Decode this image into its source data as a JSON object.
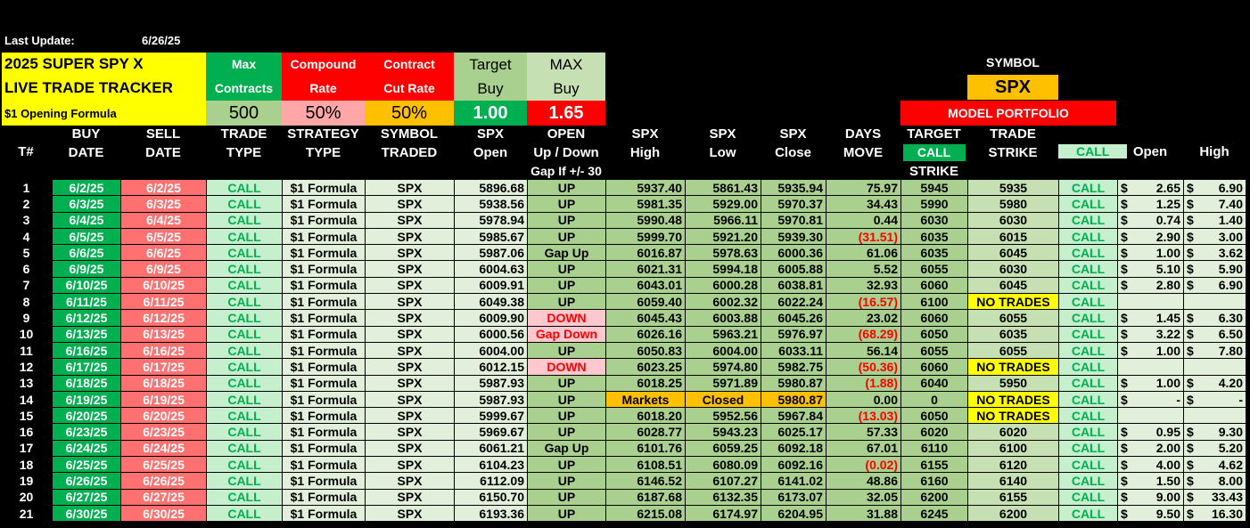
{
  "last_update_label": "Last Update:",
  "last_update_date": "6/26/25",
  "title": {
    "line1": "2025 SUPER SPY X",
    "line2": "LIVE TRADE TRACKER",
    "line3": "$1 Opening Formula"
  },
  "params": {
    "max_contracts": {
      "l1": "Max",
      "l2": "Contracts",
      "value": "500"
    },
    "compound_rate": {
      "l1": "Compound",
      "l2": "Rate",
      "value": "50%"
    },
    "cut_rate": {
      "l1": "Contract",
      "l2": "Cut Rate",
      "value": "50%"
    },
    "target_buy": {
      "l1": "Target",
      "l2": "Buy",
      "value": "1.00"
    },
    "max_buy": {
      "l1": "MAX",
      "l2": "Buy",
      "value": "1.65"
    }
  },
  "symbol_label": "SYMBOL",
  "symbol_value": "SPX",
  "model_portfolio": "MODEL PORTFOLIO",
  "headers": {
    "num": "T#",
    "buy": [
      "BUY",
      "DATE"
    ],
    "sell": [
      "SELL",
      "DATE"
    ],
    "trade_type": [
      "TRADE",
      "TYPE"
    ],
    "strategy": [
      "STRATEGY",
      "TYPE"
    ],
    "symbol": [
      "SYMBOL",
      "TRADED"
    ],
    "spx_open": [
      "SPX",
      "Open"
    ],
    "open_dir": [
      "OPEN",
      "Up / Down",
      "Gap If +/- 30"
    ],
    "spx_high": [
      "SPX",
      "High"
    ],
    "spx_low": [
      "SPX",
      "Low"
    ],
    "spx_close": [
      "SPX",
      "Close"
    ],
    "days_move": [
      "DAYS",
      "MOVE"
    ],
    "target": [
      "TARGET",
      "CALL",
      "STRIKE"
    ],
    "trade_strike": [
      "TRADE",
      "STRIKE"
    ],
    "call": "CALL",
    "open": "Open",
    "high": "High"
  },
  "rows": [
    {
      "n": "1",
      "buy": "6/2/25",
      "sell": "6/2/25",
      "type": "CALL",
      "strategy": "$1 Formula",
      "symbol": "SPX",
      "open": "5896.68",
      "dir": "UP",
      "high": "5937.40",
      "low": "5861.43",
      "close": "5935.94",
      "move": "75.97",
      "target": "5945",
      "strike": "5935",
      "call": "CALL",
      "opt_open": "2.65",
      "opt_high": "6.90"
    },
    {
      "n": "2",
      "buy": "6/3/25",
      "sell": "6/3/25",
      "type": "CALL",
      "strategy": "$1 Formula",
      "symbol": "SPX",
      "open": "5938.56",
      "dir": "UP",
      "high": "5981.35",
      "low": "5929.00",
      "close": "5970.37",
      "move": "34.43",
      "target": "5990",
      "strike": "5980",
      "call": "CALL",
      "opt_open": "1.25",
      "opt_high": "7.40"
    },
    {
      "n": "3",
      "buy": "6/4/25",
      "sell": "6/4/25",
      "type": "CALL",
      "strategy": "$1 Formula",
      "symbol": "SPX",
      "open": "5978.94",
      "dir": "UP",
      "high": "5990.48",
      "low": "5966.11",
      "close": "5970.81",
      "move": "0.44",
      "target": "6030",
      "strike": "6030",
      "call": "CALL",
      "opt_open": "0.74",
      "opt_high": "1.40"
    },
    {
      "n": "4",
      "buy": "6/5/25",
      "sell": "6/5/25",
      "type": "CALL",
      "strategy": "$1 Formula",
      "symbol": "SPX",
      "open": "5985.67",
      "dir": "UP",
      "high": "5999.70",
      "low": "5921.20",
      "close": "5939.30",
      "move": "(31.51)",
      "neg": true,
      "target": "6035",
      "strike": "6015",
      "call": "CALL",
      "opt_open": "2.90",
      "opt_high": "3.00"
    },
    {
      "n": "5",
      "buy": "6/6/25",
      "sell": "6/6/25",
      "type": "CALL",
      "strategy": "$1 Formula",
      "symbol": "SPX",
      "open": "5987.06",
      "dir": "Gap Up",
      "high": "6016.87",
      "low": "5978.63",
      "close": "6000.36",
      "move": "61.06",
      "target": "6035",
      "strike": "6045",
      "call": "CALL",
      "opt_open": "1.00",
      "opt_high": "3.62"
    },
    {
      "n": "6",
      "buy": "6/9/25",
      "sell": "6/9/25",
      "type": "CALL",
      "strategy": "$1 Formula",
      "symbol": "SPX",
      "open": "6004.63",
      "dir": "UP",
      "high": "6021.31",
      "low": "5994.18",
      "close": "6005.88",
      "move": "5.52",
      "target": "6055",
      "strike": "6030",
      "call": "CALL",
      "opt_open": "5.10",
      "opt_high": "5.90"
    },
    {
      "n": "7",
      "buy": "6/10/25",
      "sell": "6/10/25",
      "type": "CALL",
      "strategy": "$1 Formula",
      "symbol": "SPX",
      "open": "6009.91",
      "dir": "UP",
      "high": "6043.01",
      "low": "6000.28",
      "close": "6038.81",
      "move": "32.93",
      "target": "6060",
      "strike": "6045",
      "call": "CALL",
      "opt_open": "2.80",
      "opt_high": "6.90"
    },
    {
      "n": "8",
      "buy": "6/11/25",
      "sell": "6/11/25",
      "type": "CALL",
      "strategy": "$1 Formula",
      "symbol": "SPX",
      "open": "6049.38",
      "dir": "UP",
      "high": "6059.40",
      "low": "6002.32",
      "close": "6022.24",
      "move": "(16.57)",
      "neg": true,
      "target": "6100",
      "strike": "NO TRADES",
      "notrade": true,
      "call": "CALL",
      "opt_open": "",
      "opt_high": ""
    },
    {
      "n": "9",
      "buy": "6/12/25",
      "sell": "6/12/25",
      "type": "CALL",
      "strategy": "$1 Formula",
      "symbol": "SPX",
      "open": "6009.90",
      "dir": "DOWN",
      "down": true,
      "high": "6045.43",
      "low": "6003.88",
      "close": "6045.26",
      "move": "23.02",
      "target": "6060",
      "strike": "6055",
      "call": "CALL",
      "opt_open": "1.45",
      "opt_high": "6.30"
    },
    {
      "n": "10",
      "buy": "6/13/25",
      "sell": "6/13/25",
      "type": "CALL",
      "strategy": "$1 Formula",
      "symbol": "SPX",
      "open": "6000.56",
      "dir": "Gap Down",
      "down": true,
      "high": "6026.16",
      "low": "5963.21",
      "close": "5976.97",
      "move": "(68.29)",
      "neg": true,
      "target": "6050",
      "strike": "6035",
      "call": "CALL",
      "opt_open": "3.22",
      "opt_high": "6.50"
    },
    {
      "n": "11",
      "buy": "6/16/25",
      "sell": "6/16/25",
      "type": "CALL",
      "strategy": "$1 Formula",
      "symbol": "SPX",
      "open": "6004.00",
      "dir": "UP",
      "high": "6050.83",
      "low": "6004.00",
      "close": "6033.11",
      "move": "56.14",
      "target": "6055",
      "strike": "6055",
      "call": "CALL",
      "opt_open": "1.00",
      "opt_high": "7.80"
    },
    {
      "n": "12",
      "buy": "6/17/25",
      "sell": "6/17/25",
      "type": "CALL",
      "strategy": "$1 Formula",
      "symbol": "SPX",
      "open": "6012.15",
      "dir": "DOWN",
      "down": true,
      "high": "6023.25",
      "low": "5974.80",
      "close": "5982.75",
      "move": "(50.36)",
      "neg": true,
      "target": "6060",
      "strike": "NO TRADES",
      "notrade": true,
      "call": "CALL",
      "opt_open": "",
      "opt_high": ""
    },
    {
      "n": "13",
      "buy": "6/18/25",
      "sell": "6/18/25",
      "type": "CALL",
      "strategy": "$1 Formula",
      "symbol": "SPX",
      "open": "5987.93",
      "dir": "UP",
      "high": "6018.25",
      "low": "5971.89",
      "close": "5980.87",
      "move": "(1.88)",
      "neg": true,
      "target": "6040",
      "strike": "5950",
      "call": "CALL",
      "opt_open": "1.00",
      "opt_high": "4.20"
    },
    {
      "n": "14",
      "buy": "6/19/25",
      "sell": "6/19/25",
      "type": "CALL",
      "strategy": "$1 Formula",
      "symbol": "SPX",
      "open": "5987.93",
      "dir": "UP",
      "high": "Markets",
      "low": "Closed",
      "close": "5980.87",
      "closed": true,
      "move": "0.00",
      "target": "0",
      "strike": "NO TRADES",
      "notrade": true,
      "call": "CALL",
      "opt_open": "-",
      "opt_high": "-"
    },
    {
      "n": "15",
      "buy": "6/20/25",
      "sell": "6/20/25",
      "type": "CALL",
      "strategy": "$1 Formula",
      "symbol": "SPX",
      "open": "5999.67",
      "dir": "UP",
      "high": "6018.20",
      "low": "5952.56",
      "close": "5967.84",
      "move": "(13.03)",
      "neg": true,
      "target": "6050",
      "strike": "NO TRADES",
      "notrade": true,
      "call": "CALL",
      "opt_open": "",
      "opt_high": ""
    },
    {
      "n": "16",
      "buy": "6/23/25",
      "sell": "6/23/25",
      "type": "CALL",
      "strategy": "$1 Formula",
      "symbol": "SPX",
      "open": "5969.67",
      "dir": "UP",
      "high": "6028.77",
      "low": "5943.23",
      "close": "6025.17",
      "move": "57.33",
      "target": "6020",
      "strike": "6020",
      "call": "CALL",
      "opt_open": "0.95",
      "opt_high": "9.30"
    },
    {
      "n": "17",
      "buy": "6/24/25",
      "sell": "6/24/25",
      "type": "CALL",
      "strategy": "$1 Formula",
      "symbol": "SPX",
      "open": "6061.21",
      "dir": "Gap Up",
      "high": "6101.76",
      "low": "6059.25",
      "close": "6092.18",
      "move": "67.01",
      "target": "6110",
      "strike": "6100",
      "call": "CALL",
      "opt_open": "2.00",
      "opt_high": "5.20"
    },
    {
      "n": "18",
      "buy": "6/25/25",
      "sell": "6/25/25",
      "type": "CALL",
      "strategy": "$1 Formula",
      "symbol": "SPX",
      "open": "6104.23",
      "dir": "UP",
      "high": "6108.51",
      "low": "6080.09",
      "close": "6092.16",
      "move": "(0.02)",
      "neg": true,
      "target": "6155",
      "strike": "6120",
      "call": "CALL",
      "opt_open": "4.00",
      "opt_high": "4.62"
    },
    {
      "n": "19",
      "buy": "6/26/25",
      "sell": "6/26/25",
      "type": "CALL",
      "strategy": "$1 Formula",
      "symbol": "SPX",
      "open": "6112.09",
      "dir": "UP",
      "high": "6146.52",
      "low": "6107.27",
      "close": "6141.02",
      "move": "48.86",
      "target": "6160",
      "strike": "6140",
      "call": "CALL",
      "opt_open": "1.50",
      "opt_high": "8.00"
    },
    {
      "n": "20",
      "buy": "6/27/25",
      "sell": "6/27/25",
      "type": "CALL",
      "strategy": "$1 Formula",
      "symbol": "SPX",
      "open": "6150.70",
      "dir": "UP",
      "high": "6187.68",
      "low": "6132.35",
      "close": "6173.07",
      "move": "32.05",
      "target": "6200",
      "strike": "6155",
      "call": "CALL",
      "opt_open": "9.00",
      "opt_high": "33.43"
    },
    {
      "n": "21",
      "buy": "6/30/25",
      "sell": "6/30/25",
      "type": "CALL",
      "strategy": "$1 Formula",
      "symbol": "SPX",
      "open": "6193.36",
      "dir": "UP",
      "high": "6215.08",
      "low": "6174.97",
      "close": "6204.95",
      "move": "31.88",
      "target": "6245",
      "strike": "6200",
      "call": "CALL",
      "opt_open": "9.50",
      "opt_high": "16.30"
    }
  ],
  "currency_symbol": "$",
  "colors": {
    "buy_green": "#00b050",
    "sell_red": "#ff7070",
    "yellow": "#ffff00",
    "orange": "#ffc000",
    "red": "#ff0000"
  }
}
